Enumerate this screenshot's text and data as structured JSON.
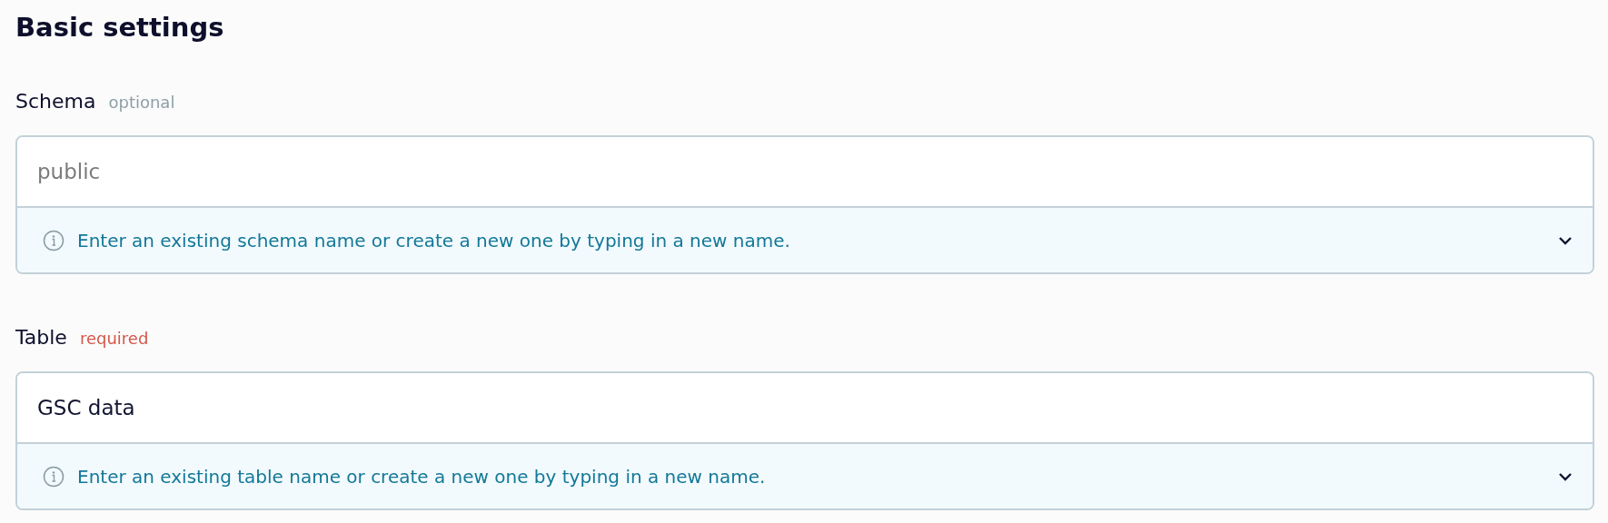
{
  "heading": "Basic settings",
  "fields": [
    {
      "label": "Schema",
      "tag": {
        "text": "optional",
        "kind": "optional"
      },
      "placeholder": "public",
      "hint": "Enter an existing schema name or create a new one by typing in a new name.",
      "expanded": false
    },
    {
      "label": "Table",
      "tag": {
        "text": "required",
        "kind": "required"
      },
      "value": "GSC data",
      "hint": "Enter an existing table name or create a new one by typing in a new name.",
      "expanded": false
    }
  ]
}
